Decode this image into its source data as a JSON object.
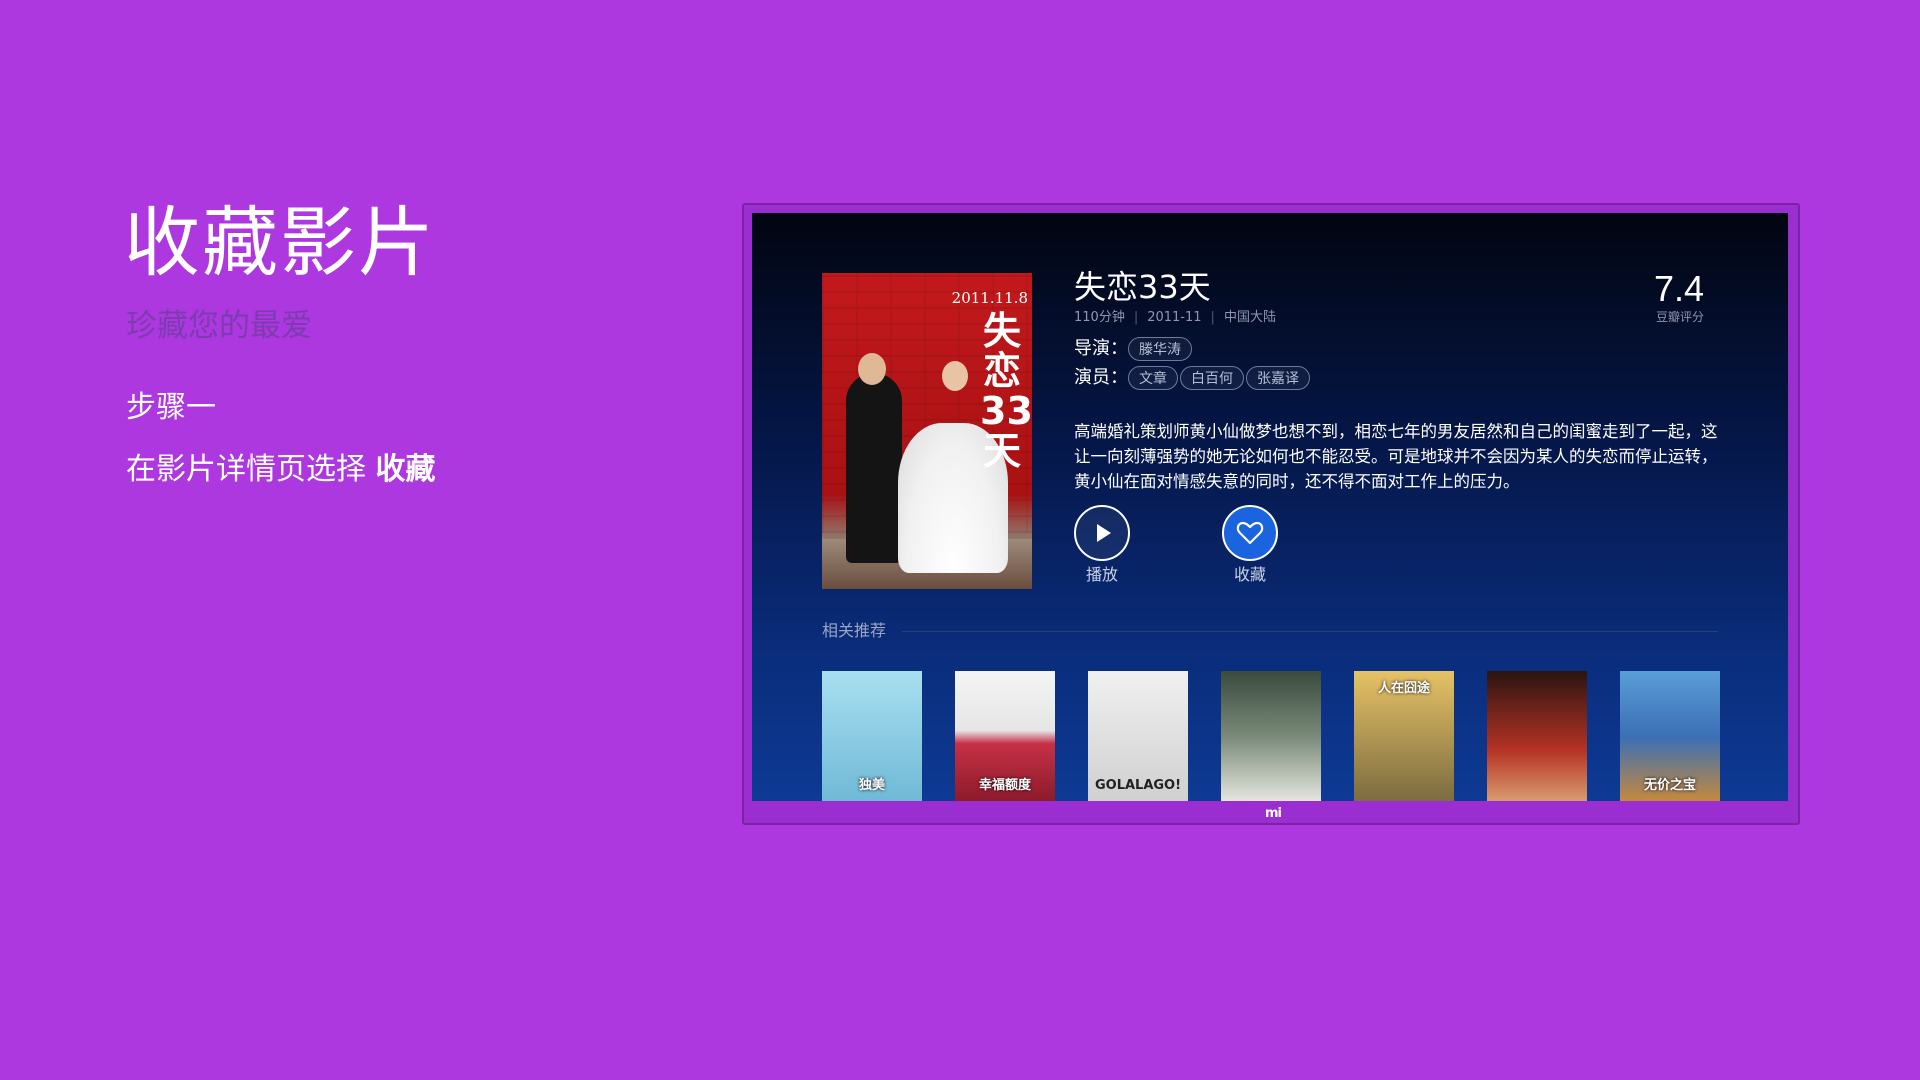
{
  "intro": {
    "title": "收藏影片",
    "subtitle": "珍藏您的最爱",
    "step": "步骤一",
    "desc_prefix": "在影片详情页选择 ",
    "desc_bold": "收藏"
  },
  "tv": {
    "brand_logo": "mi"
  },
  "movie": {
    "poster_date": "2011.11.8",
    "poster_title": "失恋33天",
    "title": "失恋33天",
    "duration": "110分钟",
    "release": "2011-11",
    "region": "中国大陆",
    "rating": "7.4",
    "rating_label": "豆瓣评分",
    "director_label": "导演：",
    "director": "滕华涛",
    "cast_label": "演员：",
    "cast": [
      "文章",
      "白百何",
      "张嘉译"
    ],
    "synopsis": "高端婚礼策划师黄小仙做梦也想不到，相恋七年的男友居然和自己的闺蜜走到了一起，这让一向刻薄强势的她无论如何也不能忍受。可是地球并不会因为某人的失恋而停止运转，黄小仙在面对情感失意的同时，还不得不面对工作上的压力。"
  },
  "actions": {
    "play_label": "播放",
    "favorite_label": "收藏",
    "play_icon": "play-icon",
    "favorite_icon": "heart-icon"
  },
  "related": {
    "title": "相关推荐",
    "items": [
      {
        "caption": "独美",
        "color": "#7fc6e0"
      },
      {
        "caption": "幸福额度",
        "color": "#c73046"
      },
      {
        "caption": "GOLALAGO!",
        "color": "#d8d8d8"
      },
      {
        "caption": "",
        "color": "#5e7a6a"
      },
      {
        "caption": "人在囧途",
        "color": "#c79b3c"
      },
      {
        "caption": "",
        "color": "#b53325"
      },
      {
        "caption": "无价之宝",
        "color": "#3b6fb5"
      }
    ]
  }
}
